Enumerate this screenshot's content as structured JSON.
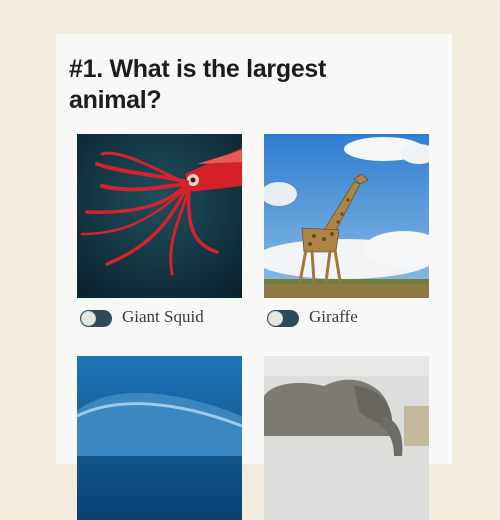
{
  "question": {
    "title": "#1. What is the largest animal?"
  },
  "options": [
    {
      "label": "Giant Squid",
      "icon": "giant-squid-image",
      "selected": false
    },
    {
      "label": "Giraffe",
      "icon": "giraffe-image",
      "selected": false
    },
    {
      "label": "",
      "icon": "whale-image",
      "selected": false
    },
    {
      "label": "",
      "icon": "elephant-image",
      "selected": false
    }
  ],
  "colors": {
    "page_bg": "#f2ecdc",
    "card_bg": "#f8f8f7",
    "toggle_track": "#2e4a5a"
  }
}
